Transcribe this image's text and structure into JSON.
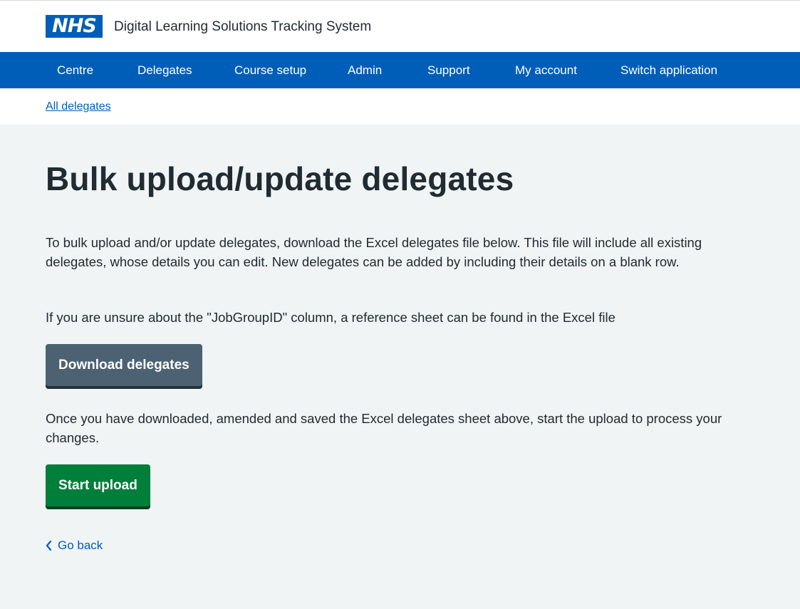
{
  "header": {
    "logo_text": "NHS",
    "service_name": "Digital Learning Solutions Tracking System"
  },
  "nav": {
    "items": [
      {
        "label": "Centre"
      },
      {
        "label": "Delegates"
      },
      {
        "label": "Course setup"
      },
      {
        "label": "Admin"
      },
      {
        "label": "Support"
      },
      {
        "label": "My account"
      },
      {
        "label": "Switch application"
      }
    ]
  },
  "breadcrumb": {
    "label": "All delegates"
  },
  "main": {
    "title": "Bulk upload/update delegates",
    "intro": "To bulk upload and/or update delegates, download the Excel delegates file below. This file will include all existing delegates, whose details you can edit. New delegates can be added by including their details on a blank row.",
    "jobgroup_note": "If you are unsure about the \"JobGroupID\" column, a reference sheet can be found in the Excel file",
    "download_button": "Download delegates",
    "upload_instructions": "Once you have downloaded, amended and saved the Excel delegates sheet above, start the upload to process your changes.",
    "start_button": "Start upload",
    "back_link": "Go back"
  },
  "colors": {
    "nhs_blue": "#005eb8",
    "secondary_button": "#4c6272",
    "primary_button": "#007f3b",
    "page_background": "#f0f4f5"
  }
}
